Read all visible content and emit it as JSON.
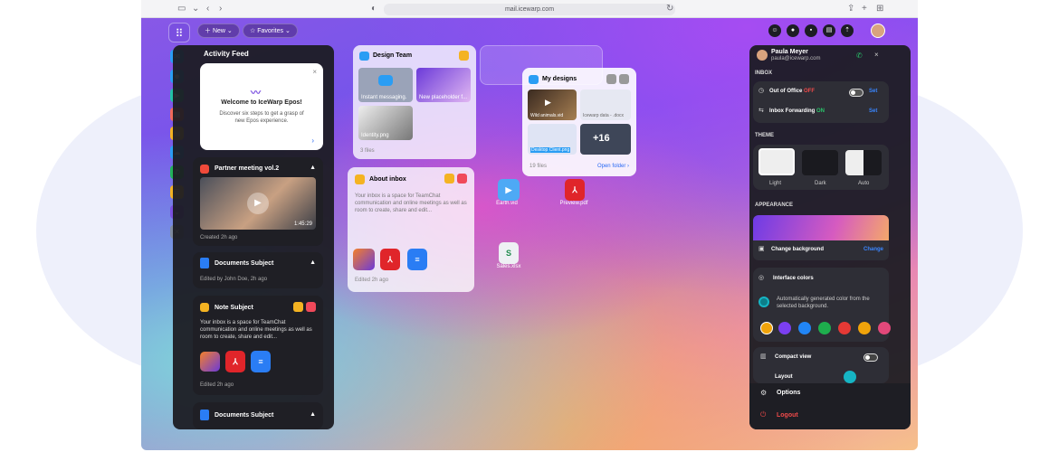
{
  "browser": {
    "url": "mail.icewarp.com"
  },
  "toolbar": {
    "new_label": "New",
    "favorites_label": "Favorites"
  },
  "activity_feed": {
    "title": "Activity Feed",
    "welcome": {
      "title": "Welcome to IceWarp Epos!",
      "text": "Discover six steps to get a grasp of new Epos experience."
    },
    "partner_meeting": {
      "title": "Partner meeting vol.2",
      "duration": "1:45:29",
      "meta": "Created 2h ago"
    },
    "documents1": {
      "title": "Documents Subject",
      "meta": "Edited by John Doe, 2h ago"
    },
    "note": {
      "title": "Note Subject",
      "text": "Your inbox is a space for TeamChat communication and online meetings as well as room to create, share and edit...",
      "meta": "Edited 2h ago"
    },
    "documents2": {
      "title": "Documents Subject"
    }
  },
  "design_team": {
    "title": "Design Team",
    "files": [
      "Instant messaging.",
      "New placeholder f...",
      "Identity.png"
    ],
    "count": "3 files"
  },
  "about_inbox": {
    "title": "About inbox",
    "text": "Your inbox is a space for TeamChat communication and online meetings as well as room to create, share and edit...",
    "meta": "Edited 2h ago"
  },
  "my_designs": {
    "title": "My designs",
    "files": [
      "Wild animals.vid",
      "Icewarp data - .docx",
      "Desktop Client.png"
    ],
    "more": "+16",
    "count": "19 files",
    "open_folder": "Open folder"
  },
  "desktop_files": {
    "earth": "Earth.vid",
    "preview": "Preview.pdf",
    "sales": "Sales.xlsx"
  },
  "profile": {
    "name": "Paula Meyer",
    "email": "paula@icewarp.com",
    "inbox_heading": "INBOX",
    "out_of_office": "Out of Office",
    "out_of_office_status": "OFF",
    "set_label": "Set",
    "forwarding": "Inbox Forwarding",
    "forwarding_status": "ON",
    "theme_heading": "THEME",
    "themes": [
      "Light",
      "Dark",
      "Auto"
    ],
    "appearance_heading": "APPEARANCE",
    "change_background": "Change background",
    "change_label": "Change",
    "interface_colors": "Interface colors",
    "auto_color_text": "Automatically generated color from the selected background.",
    "compact_view": "Compact view",
    "layout": "Layout",
    "options": "Options",
    "logout": "Logout",
    "colors": [
      "#7b3ff0",
      "#2185f5",
      "#1eae4d",
      "#e53935",
      "#f0a30a",
      "#e2487a"
    ],
    "accent": "#16b5c4"
  }
}
